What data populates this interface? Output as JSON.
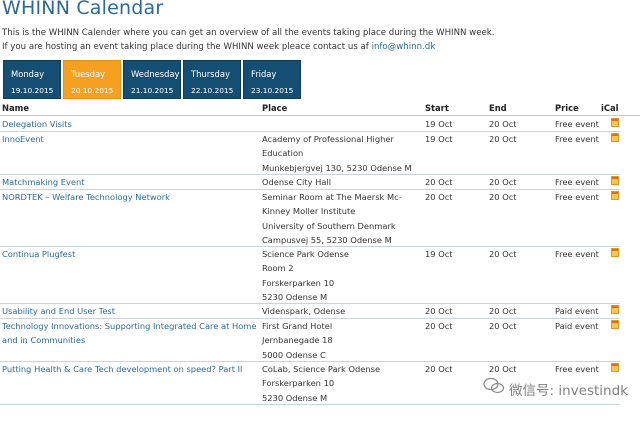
{
  "header": {
    "title": "WHINN Calendar",
    "intro_line1": "This is the WHINN Calender where you can get an overview of all the events taking place during the WHINN week.",
    "intro_line2": "If you are hosting an event taking place during the WHINN week pleace contact us af",
    "contact_email": "info@whinn.dk"
  },
  "tabs": [
    {
      "day": "Monday",
      "date": "19.10.2015",
      "active": false
    },
    {
      "day": "Tuesday",
      "date": "20.10.2015",
      "active": true
    },
    {
      "day": "Wednesday",
      "date": "21.10.2015",
      "active": false
    },
    {
      "day": "Thursday",
      "date": "22.10.2015",
      "active": false
    },
    {
      "day": "Friday",
      "date": "23.10.2015",
      "active": false
    }
  ],
  "columns": {
    "name": "Name",
    "place": "Place",
    "start": "Start",
    "end": "End",
    "price": "Price",
    "ical": "iCal"
  },
  "events": [
    {
      "name": "Delegation Visits",
      "place": [],
      "start": "19 Oct",
      "end": "20 Oct",
      "price": "Free event",
      "ical_icon": "calendar-icon"
    },
    {
      "name": "InnoEvent",
      "place": [
        "Academy of Professional Higher",
        "Education",
        "Munkebjergvej 130, 5230 Odense M"
      ],
      "start": "19 Oct",
      "end": "20 Oct",
      "price": "Free event",
      "ical_icon": "calendar-icon"
    },
    {
      "name": "Matchmaking Event",
      "place": [
        "Odense City Hall"
      ],
      "start": "20 Oct",
      "end": "20 Oct",
      "price": "Free event",
      "ical_icon": "calendar-icon"
    },
    {
      "name": "NORDTEK – Welfare Technology Network",
      "place": [
        "Seminar Room at The Maersk Mc-",
        "Kinney Moller Institute",
        "University of Southern Denmark",
        "Campusvej 55, 5230 Odense M"
      ],
      "start": "20 Oct",
      "end": "20 Oct",
      "price": "Free event",
      "ical_icon": "calendar-icon"
    },
    {
      "name": "Continua Plugfest",
      "place": [
        "Science Park Odense",
        "Room 2",
        "Forskerparken 10",
        "5230 Odense M"
      ],
      "start": "19 Oct",
      "end": "20 Oct",
      "price": "Free event",
      "ical_icon": "calendar-icon"
    },
    {
      "name": "Usability and End User Test",
      "place": [
        "Videnspark, Odense"
      ],
      "start": "20 Oct",
      "end": "20 Oct",
      "price": "Paid event",
      "ical_icon": "calendar-icon"
    },
    {
      "name": "Technology Innovations: Supporting Integrated Care at Home and in Communities",
      "place": [
        "First Grand Hotel",
        "Jernbanegade 18",
        "5000 Odense C"
      ],
      "start": "20 Oct",
      "end": "20 Oct",
      "price": "Paid event",
      "ical_icon": "calendar-icon"
    },
    {
      "name": "Putting Health & Care Tech development on speed? Part II",
      "place": [
        "CoLab, Science Park Odense",
        "Forskerparken 10",
        "5230 Odense M"
      ],
      "start": "20 Oct",
      "end": "20 Oct",
      "price": "Free event",
      "ical_icon": "calendar-icon"
    }
  ],
  "watermark": {
    "text": "微信号: investindk",
    "icon": "wechat-icon"
  }
}
